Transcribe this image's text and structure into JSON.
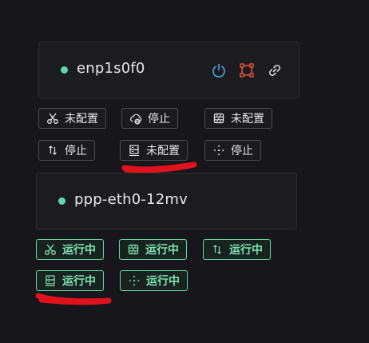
{
  "colors": {
    "background": "#17171b",
    "card": "#1c1c20",
    "status_green": "#5fd9a8",
    "power_icon": "#4aa3df",
    "node_icon": "#e8553e",
    "annotation_red": "#e0121c"
  },
  "interface_1": {
    "name": "enp1s0f0",
    "icons": [
      "power-icon",
      "node-graph-icon",
      "link-icon"
    ],
    "tags": [
      {
        "icon": "scissors-icon",
        "label": "未配置"
      },
      {
        "icon": "cloud-globe-icon",
        "label": "停止"
      },
      {
        "icon": "firewall-icon",
        "label": "未配置"
      },
      {
        "icon": "up-down-arrows-icon",
        "label": "停止"
      },
      {
        "icon": "server-icon",
        "label": "未配置"
      },
      {
        "icon": "move-arrows-icon",
        "label": "停止"
      }
    ]
  },
  "interface_2": {
    "name": "ppp-eth0-12mv",
    "tags": [
      {
        "icon": "scissors-icon",
        "label": "运行中"
      },
      {
        "icon": "firewall-icon",
        "label": "运行中"
      },
      {
        "icon": "up-down-arrows-icon",
        "label": "运行中"
      },
      {
        "icon": "server-icon",
        "label": "运行中"
      },
      {
        "icon": "move-arrows-icon",
        "label": "运行中"
      }
    ]
  }
}
